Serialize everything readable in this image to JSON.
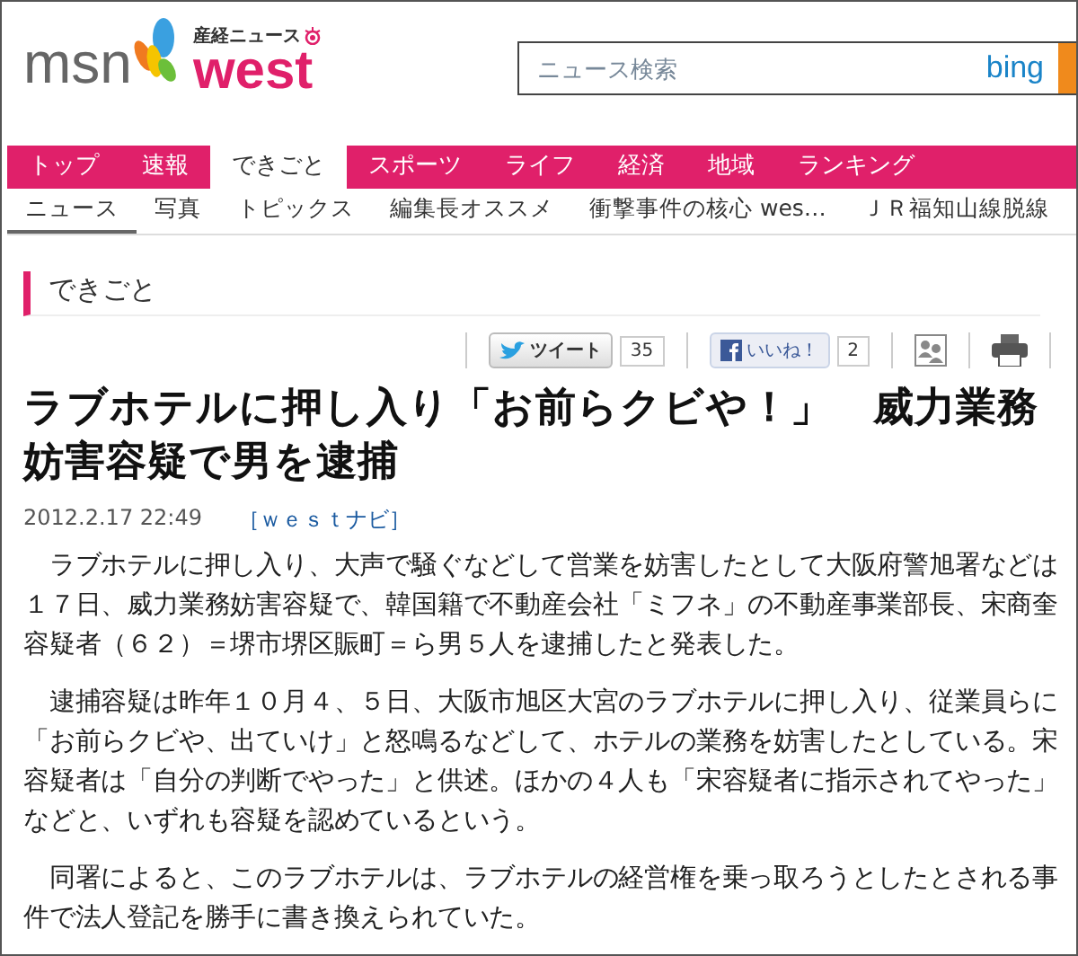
{
  "header": {
    "logo_msn": "msn",
    "logo_brand": "産経ニュース",
    "logo_west": "west",
    "search": {
      "placeholder": "ニュース検索",
      "engine": "bing"
    }
  },
  "nav": [
    {
      "label": "トップ",
      "selected": false
    },
    {
      "label": "速報",
      "selected": false
    },
    {
      "label": "できごと",
      "selected": true
    },
    {
      "label": "スポーツ",
      "selected": false
    },
    {
      "label": "ライフ",
      "selected": false
    },
    {
      "label": "経済",
      "selected": false
    },
    {
      "label": "地域",
      "selected": false
    },
    {
      "label": "ランキング",
      "selected": false
    }
  ],
  "subnav": [
    {
      "label": "ニュース",
      "selected": true
    },
    {
      "label": "写真",
      "selected": false
    },
    {
      "label": "トピックス",
      "selected": false
    },
    {
      "label": "編集長オススメ",
      "selected": false
    },
    {
      "label": "衝撃事件の核心 wes…",
      "selected": false
    },
    {
      "label": "ＪＲ福知山線脱線",
      "selected": false
    }
  ],
  "section_title": "できごと",
  "social": {
    "tweet_label": "ツイート",
    "tweet_count": "35",
    "like_label": "いいね！",
    "like_count": "2"
  },
  "article": {
    "headline": "ラブホテルに押し入り「お前らクビや！」　威力業務妨害容疑で男を逮捕",
    "date": "2012.2.17 22:49",
    "tag": "［ｗｅｓｔナビ］",
    "paragraphs": [
      "　ラブホテルに押し入り、大声で騒ぐなどして営業を妨害したとして大阪府警旭署などは１７日、威力業務妨害容疑で、韓国籍で不動産会社「ミフネ」の不動産事業部長、宋商奎容疑者（６２）＝堺市堺区賑町＝ら男５人を逮捕したと発表した。",
      "　逮捕容疑は昨年１０月４、５日、大阪市旭区大宮のラブホテルに押し入り、従業員らに「お前らクビや、出ていけ」と怒鳴るなどして、ホテルの業務を妨害したとしている。宋容疑者は「自分の判断でやった」と供述。ほかの４人も「宋容疑者に指示されてやった」などと、いずれも容疑を認めているという。",
      "　同署によると、このラブホテルは、ラブホテルの経営権を乗っ取ろうとしたとされる事件で法人登記を勝手に書き換えられていた。"
    ]
  }
}
